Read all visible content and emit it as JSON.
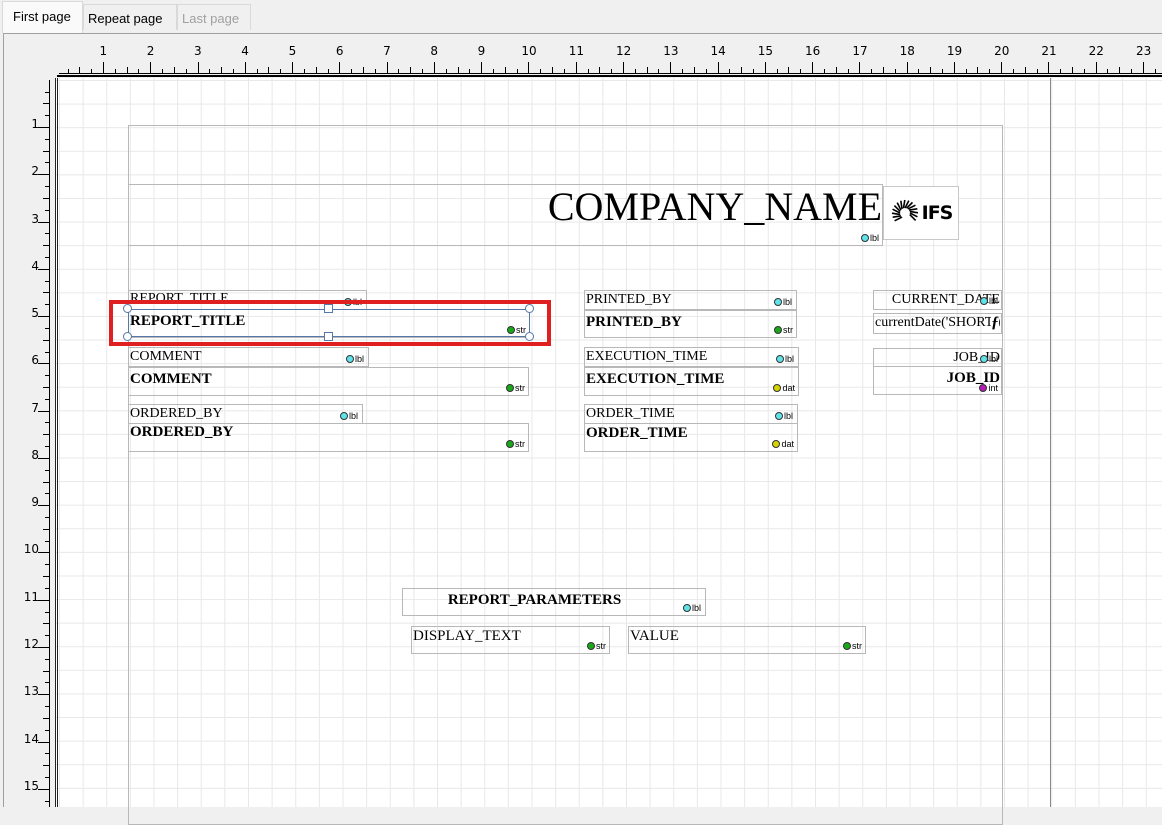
{
  "tabs": [
    {
      "label": "First page",
      "state": "active"
    },
    {
      "label": "Repeat page",
      "state": "normal"
    },
    {
      "label": "Last page",
      "state": "disabled"
    }
  ],
  "ruler": {
    "horizontal": [
      "1",
      "2",
      "3",
      "4",
      "5",
      "6",
      "7",
      "8",
      "9",
      "10",
      "11",
      "12",
      "13",
      "14",
      "15",
      "16",
      "17",
      "18",
      "19",
      "20",
      "21",
      "22",
      "23"
    ],
    "vertical": [
      "1",
      "2",
      "3",
      "4",
      "5",
      "6",
      "7",
      "8",
      "9",
      "10",
      "11",
      "12",
      "13",
      "14",
      "15"
    ]
  },
  "badge_colors": {
    "lbl": "#5fe3ea",
    "str": "#1aa81a",
    "dat": "#d6d400",
    "int": "#b31cb3"
  },
  "header": {
    "company_name": "COMPANY_NAME",
    "company_badge": "lbl",
    "logo_text": "IFS"
  },
  "fields": {
    "report_title_label": {
      "text": "REPORT_TITLE",
      "badge": "lbl"
    },
    "report_title": {
      "text": "REPORT_TITLE",
      "badge": "str"
    },
    "comment_label": {
      "text": "COMMENT",
      "badge": "lbl"
    },
    "comment": {
      "text": "COMMENT",
      "badge": "str"
    },
    "ordered_by_label": {
      "text": "ORDERED_BY",
      "badge": "lbl"
    },
    "ordered_by": {
      "text": "ORDERED_BY",
      "badge": "str"
    },
    "printed_by_label": {
      "text": "PRINTED_BY",
      "badge": "lbl"
    },
    "printed_by": {
      "text": "PRINTED_BY",
      "badge": "str"
    },
    "execution_time_label": {
      "text": "EXECUTION_TIME",
      "badge": "lbl"
    },
    "execution_time": {
      "text": "EXECUTION_TIME",
      "badge": "dat"
    },
    "order_time_label": {
      "text": "ORDER_TIME",
      "badge": "lbl"
    },
    "order_time": {
      "text": "ORDER_TIME",
      "badge": "dat"
    },
    "current_date_label": {
      "text": "CURRENT_DATE",
      "badge": "lbl"
    },
    "current_date": {
      "text": "currentDate('SHORT')",
      "badge": "f"
    },
    "job_id_label": {
      "text": "JOB_ID",
      "badge": "lbl"
    },
    "job_id": {
      "text": "JOB_ID",
      "badge": "int"
    },
    "report_parameters": {
      "text": "REPORT_PARAMETERS",
      "badge": "lbl"
    },
    "display_text": {
      "text": "DISPLAY_TEXT",
      "badge": "str"
    },
    "value": {
      "text": "VALUE",
      "badge": "str"
    }
  }
}
